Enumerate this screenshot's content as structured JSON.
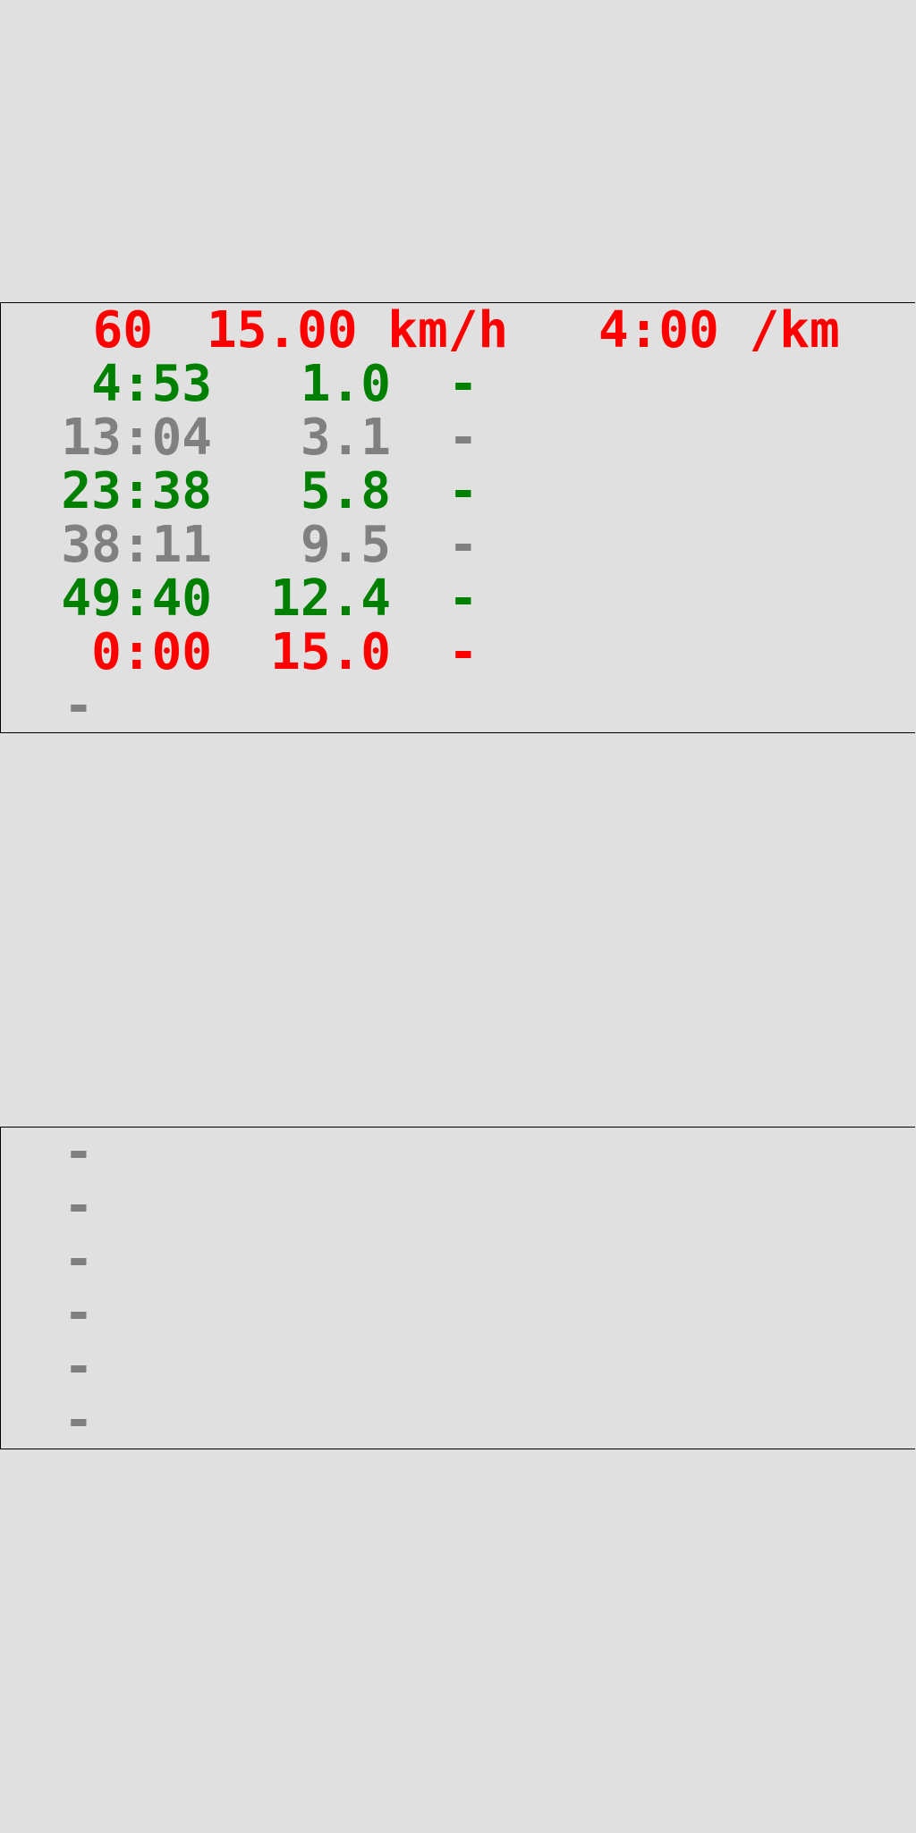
{
  "header": {
    "minutes": "60",
    "speed": "15.00 km/h",
    "pace": "4:00 /km"
  },
  "splits": [
    {
      "time": "4:53",
      "distance": "1.0",
      "delta": "-",
      "state": "green"
    },
    {
      "time": "13:04",
      "distance": "3.1",
      "delta": "-",
      "state": "gray"
    },
    {
      "time": "23:38",
      "distance": "5.8",
      "delta": "-",
      "state": "green"
    },
    {
      "time": "38:11",
      "distance": "9.5",
      "delta": "-",
      "state": "gray"
    },
    {
      "time": "49:40",
      "distance": "12.4",
      "delta": "-",
      "state": "green"
    },
    {
      "time": "0:00",
      "distance": "15.0",
      "delta": "-",
      "state": "red"
    }
  ],
  "top_trailing": "-",
  "bottom_items": [
    "-",
    "-",
    "-",
    "-",
    "-",
    "-"
  ],
  "colors": {
    "background": "#e0e0e0",
    "accent_red": "#ff0000",
    "done_green": "#008000",
    "pending_gray": "#808080"
  }
}
